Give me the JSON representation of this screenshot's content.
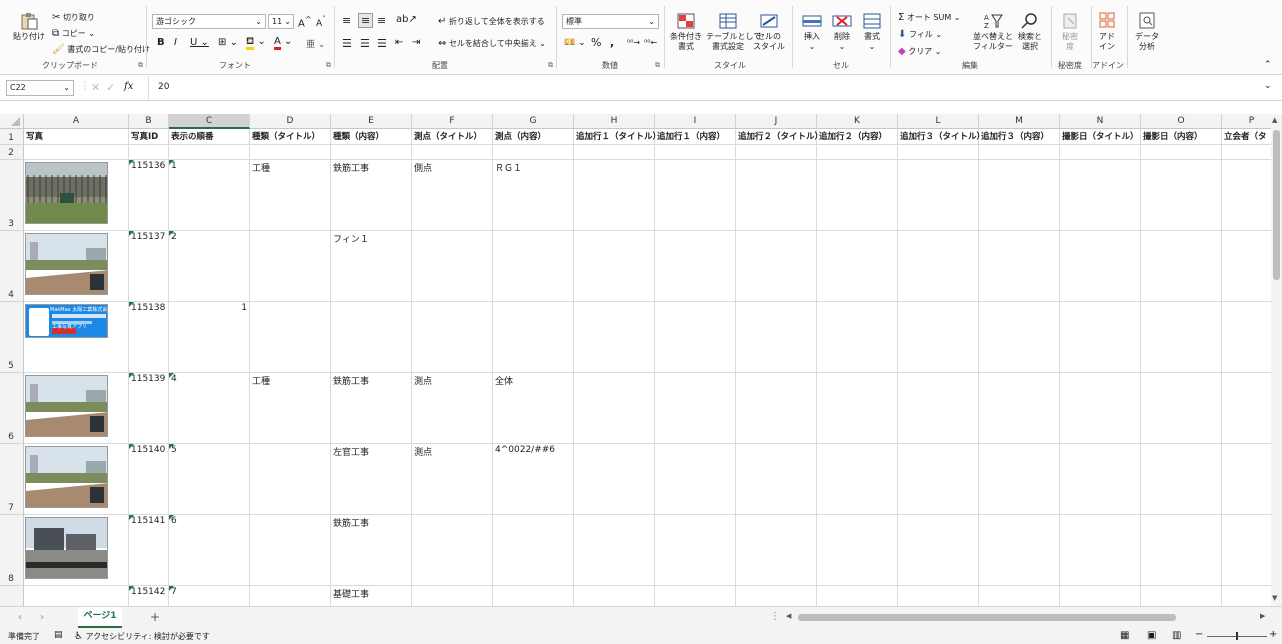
{
  "ribbon": {
    "clipboard": {
      "paste": "貼り付け",
      "cut": "切り取り",
      "copy": "コピー",
      "format_painter": "書式のコピー/貼り付け",
      "label": "クリップボード"
    },
    "font": {
      "name": "游ゴシック",
      "size": "11",
      "label": "フォント"
    },
    "alignment": {
      "wrap_text": "折り返して全体を表示する",
      "merge_center": "セルを結合して中央揃え",
      "label": "配置"
    },
    "number": {
      "format": "標準",
      "label": "数値"
    },
    "styles": {
      "conditional": "条件付き\n書式",
      "as_table": "テーブルとして\n書式設定",
      "cell_styles": "セルの\nスタイル",
      "label": "スタイル"
    },
    "cells": {
      "insert": "挿入",
      "delete": "削除",
      "format": "書式",
      "label": "セル"
    },
    "editing": {
      "autosum": "オート SUM",
      "fill": "フィル",
      "clear": "クリア",
      "sort_filter": "並べ替えと\nフィルター",
      "find_select": "検索と\n選択",
      "label": "編集"
    },
    "sensitivity": {
      "button": "秘密\n度",
      "label": "秘密度"
    },
    "addins": {
      "button": "アド\nイン",
      "label": "アドイン"
    },
    "analysis": {
      "button": "データ\n分析"
    }
  },
  "formula_bar": {
    "name_box": "C22",
    "fx": "fx",
    "value": "20"
  },
  "columns": [
    "A",
    "B",
    "C",
    "D",
    "E",
    "F",
    "G",
    "H",
    "I",
    "J",
    "K",
    "L",
    "M",
    "N",
    "O",
    "P"
  ],
  "selected_column": "C",
  "rows": [
    {
      "num": "1",
      "cells": [
        "写真",
        "写真ID",
        "表示の順番",
        "種類（タイトル）",
        "種類（内容）",
        "測点（タイトル）",
        "測点（内容）",
        "追加行１（タイトル）",
        "追加行１（内容）",
        "追加行２（タイトル）",
        "追加行２（内容）",
        "追加行３（タイトル）",
        "追加行３（内容）",
        "撮影日（タイトル）",
        "撮影日（内容）",
        "立会者（タ"
      ]
    },
    {
      "num": "2",
      "cells": [
        "",
        "",
        "",
        "",
        "",
        "",
        "",
        "",
        "",
        "",
        "",
        "",
        "",
        "",
        "",
        ""
      ]
    },
    {
      "num": "3",
      "cells": [
        "",
        "115136",
        "1",
        "工種",
        "鉄筋工事",
        "側点",
        "ＲＧ１",
        "",
        "",
        "",
        "",
        "",
        "",
        "",
        "",
        ""
      ]
    },
    {
      "num": "4",
      "cells": [
        "",
        "115137",
        "2",
        "",
        "フィン１",
        "",
        "",
        "",
        "",
        "",
        "",
        "",
        "",
        "",
        "",
        ""
      ]
    },
    {
      "num": "5",
      "cells": [
        "",
        "115138",
        "1",
        "",
        "",
        "",
        "",
        "",
        "",
        "",
        "",
        "",
        "",
        "",
        "",
        ""
      ]
    },
    {
      "num": "6",
      "cells": [
        "",
        "115139",
        "4",
        "工種",
        "鉄筋工事",
        "測点",
        "全体",
        "",
        "",
        "",
        "",
        "",
        "",
        "",
        "",
        ""
      ]
    },
    {
      "num": "7",
      "cells": [
        "",
        "115140",
        "5",
        "",
        "左官工事",
        "測点",
        "4^0022/##6",
        "",
        "",
        "",
        "",
        "",
        "",
        "",
        "",
        ""
      ]
    },
    {
      "num": "8",
      "cells": [
        "",
        "115141",
        "6",
        "",
        "鉄筋工事",
        "",
        "",
        "",
        "",
        "",
        "",
        "",
        "",
        "",
        "",
        ""
      ]
    },
    {
      "num": "9",
      "cells": [
        "",
        "115142",
        "7",
        "",
        "基礎工事",
        "",
        "",
        "",
        "",
        "",
        "",
        "",
        "",
        "",
        "",
        ""
      ]
    }
  ],
  "photo_banner": {
    "line1": "MakMax 太陽工業株式会社",
    "line2": "工事写真アプリ"
  },
  "sheet_tab": "ページ1",
  "status": {
    "ready": "準備完了",
    "accessibility": "アクセシビリティ: 検討が必要です"
  }
}
